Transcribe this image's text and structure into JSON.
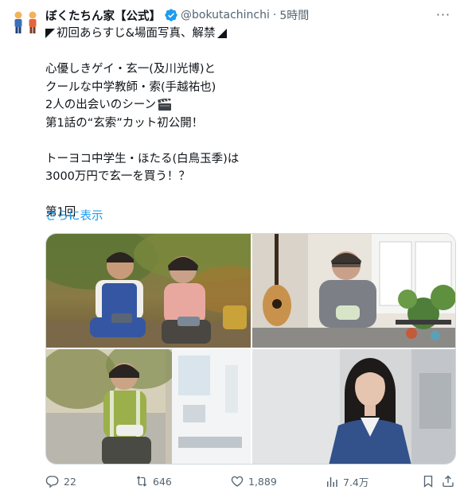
{
  "author": {
    "display_name": "ぼくたちん家【公式】",
    "handle": "@bokutachinchi",
    "separator": "·",
    "time": "5時間"
  },
  "colors": {
    "verified": "#1d9bf0",
    "link": "#1d9bf0",
    "text": "#0f1419",
    "muted": "#536471",
    "border": "#cfd9de"
  },
  "icons": {
    "verified": "verified-badge-icon",
    "more": "more-icon",
    "reply": "reply-icon",
    "retweet": "retweet-icon",
    "like": "heart-icon",
    "views": "views-icon",
    "bookmark": "bookmark-icon",
    "share": "share-icon",
    "clapper": "clapper-board-emoji"
  },
  "more_label": "···",
  "tweet": {
    "line1": "初回あらすじ&場面写真、解禁",
    "line2": "心優しきゲイ・玄一(及川光博)と",
    "line3": "クールな中学教師・索(手越祐也)",
    "line4": "2人の出会いのシーン",
    "line5": "第1話の“玄索”カット初公開！",
    "line6": "トーヨコ中学生・ほたる(白鳥玉季)は",
    "line7": "3000万円で玄一を買う！？",
    "line8": "第1回",
    "show_more": "さらに表示"
  },
  "stats": {
    "replies": "22",
    "retweets": "646",
    "likes": "1,889",
    "views": "7.4万"
  }
}
